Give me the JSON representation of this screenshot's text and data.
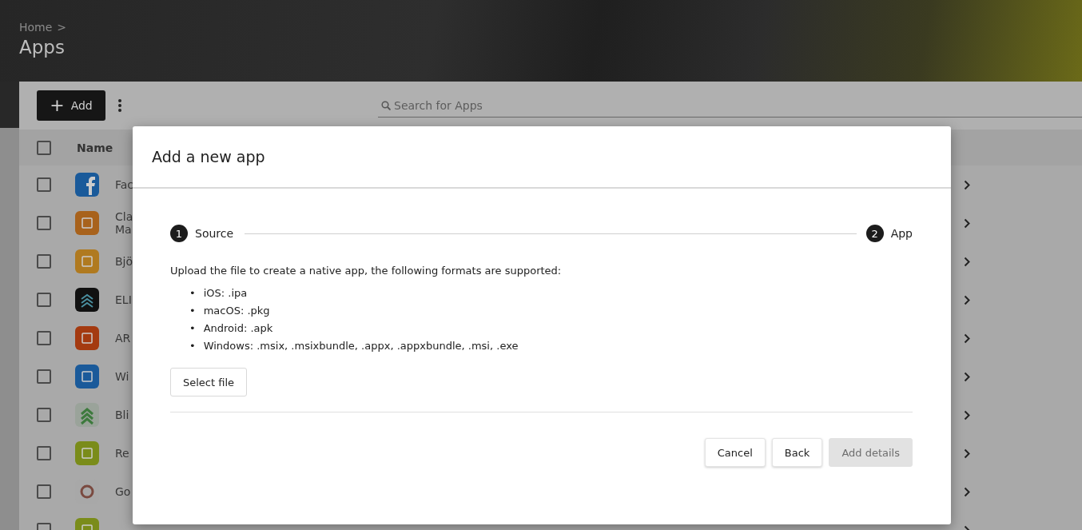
{
  "breadcrumb": {
    "parent": "Home",
    "separator": ">"
  },
  "page_title": "Apps",
  "toolbar": {
    "add_button": {
      "icon": "+",
      "label": "Add"
    },
    "search": {
      "placeholder": "Search for Apps"
    }
  },
  "table": {
    "select_all": {
      "checked": false
    },
    "columns": [
      {
        "label": "Name"
      }
    ],
    "rows": [
      {
        "name": "Fac",
        "checked": false
      },
      {
        "name": "Cla\nMa",
        "checked": false
      },
      {
        "name": "Bjö",
        "checked": false
      },
      {
        "name": "ELI",
        "checked": false
      },
      {
        "name": "AR",
        "checked": false
      },
      {
        "name": "Wi",
        "checked": false
      },
      {
        "name": "Bli",
        "checked": false
      },
      {
        "name": "Re",
        "checked": false
      },
      {
        "name": "Go",
        "checked": false
      },
      {
        "checked": false
      }
    ]
  },
  "dialog": {
    "title": "Add a new app",
    "steps": [
      {
        "number": "1",
        "label": "Source"
      },
      {
        "number": "2",
        "label": "App"
      }
    ],
    "intro": "Upload the file to create a native app, the following formats are supported:",
    "formats": [
      {
        "bullet": "•",
        "text": "iOS: .ipa"
      },
      {
        "bullet": "•",
        "text": "macOS: .pkg"
      },
      {
        "bullet": "•",
        "text": "Android: .apk"
      },
      {
        "bullet": "•",
        "text": "Windows: .msix, .msixbundle, .appx, .appxbundle, .msi, .exe"
      }
    ],
    "select_button": "Select file",
    "buttons": [
      {
        "label": "Cancel",
        "disabled": false
      },
      {
        "label": "Back",
        "disabled": false
      },
      {
        "label": "Add details",
        "disabled": true
      }
    ]
  }
}
